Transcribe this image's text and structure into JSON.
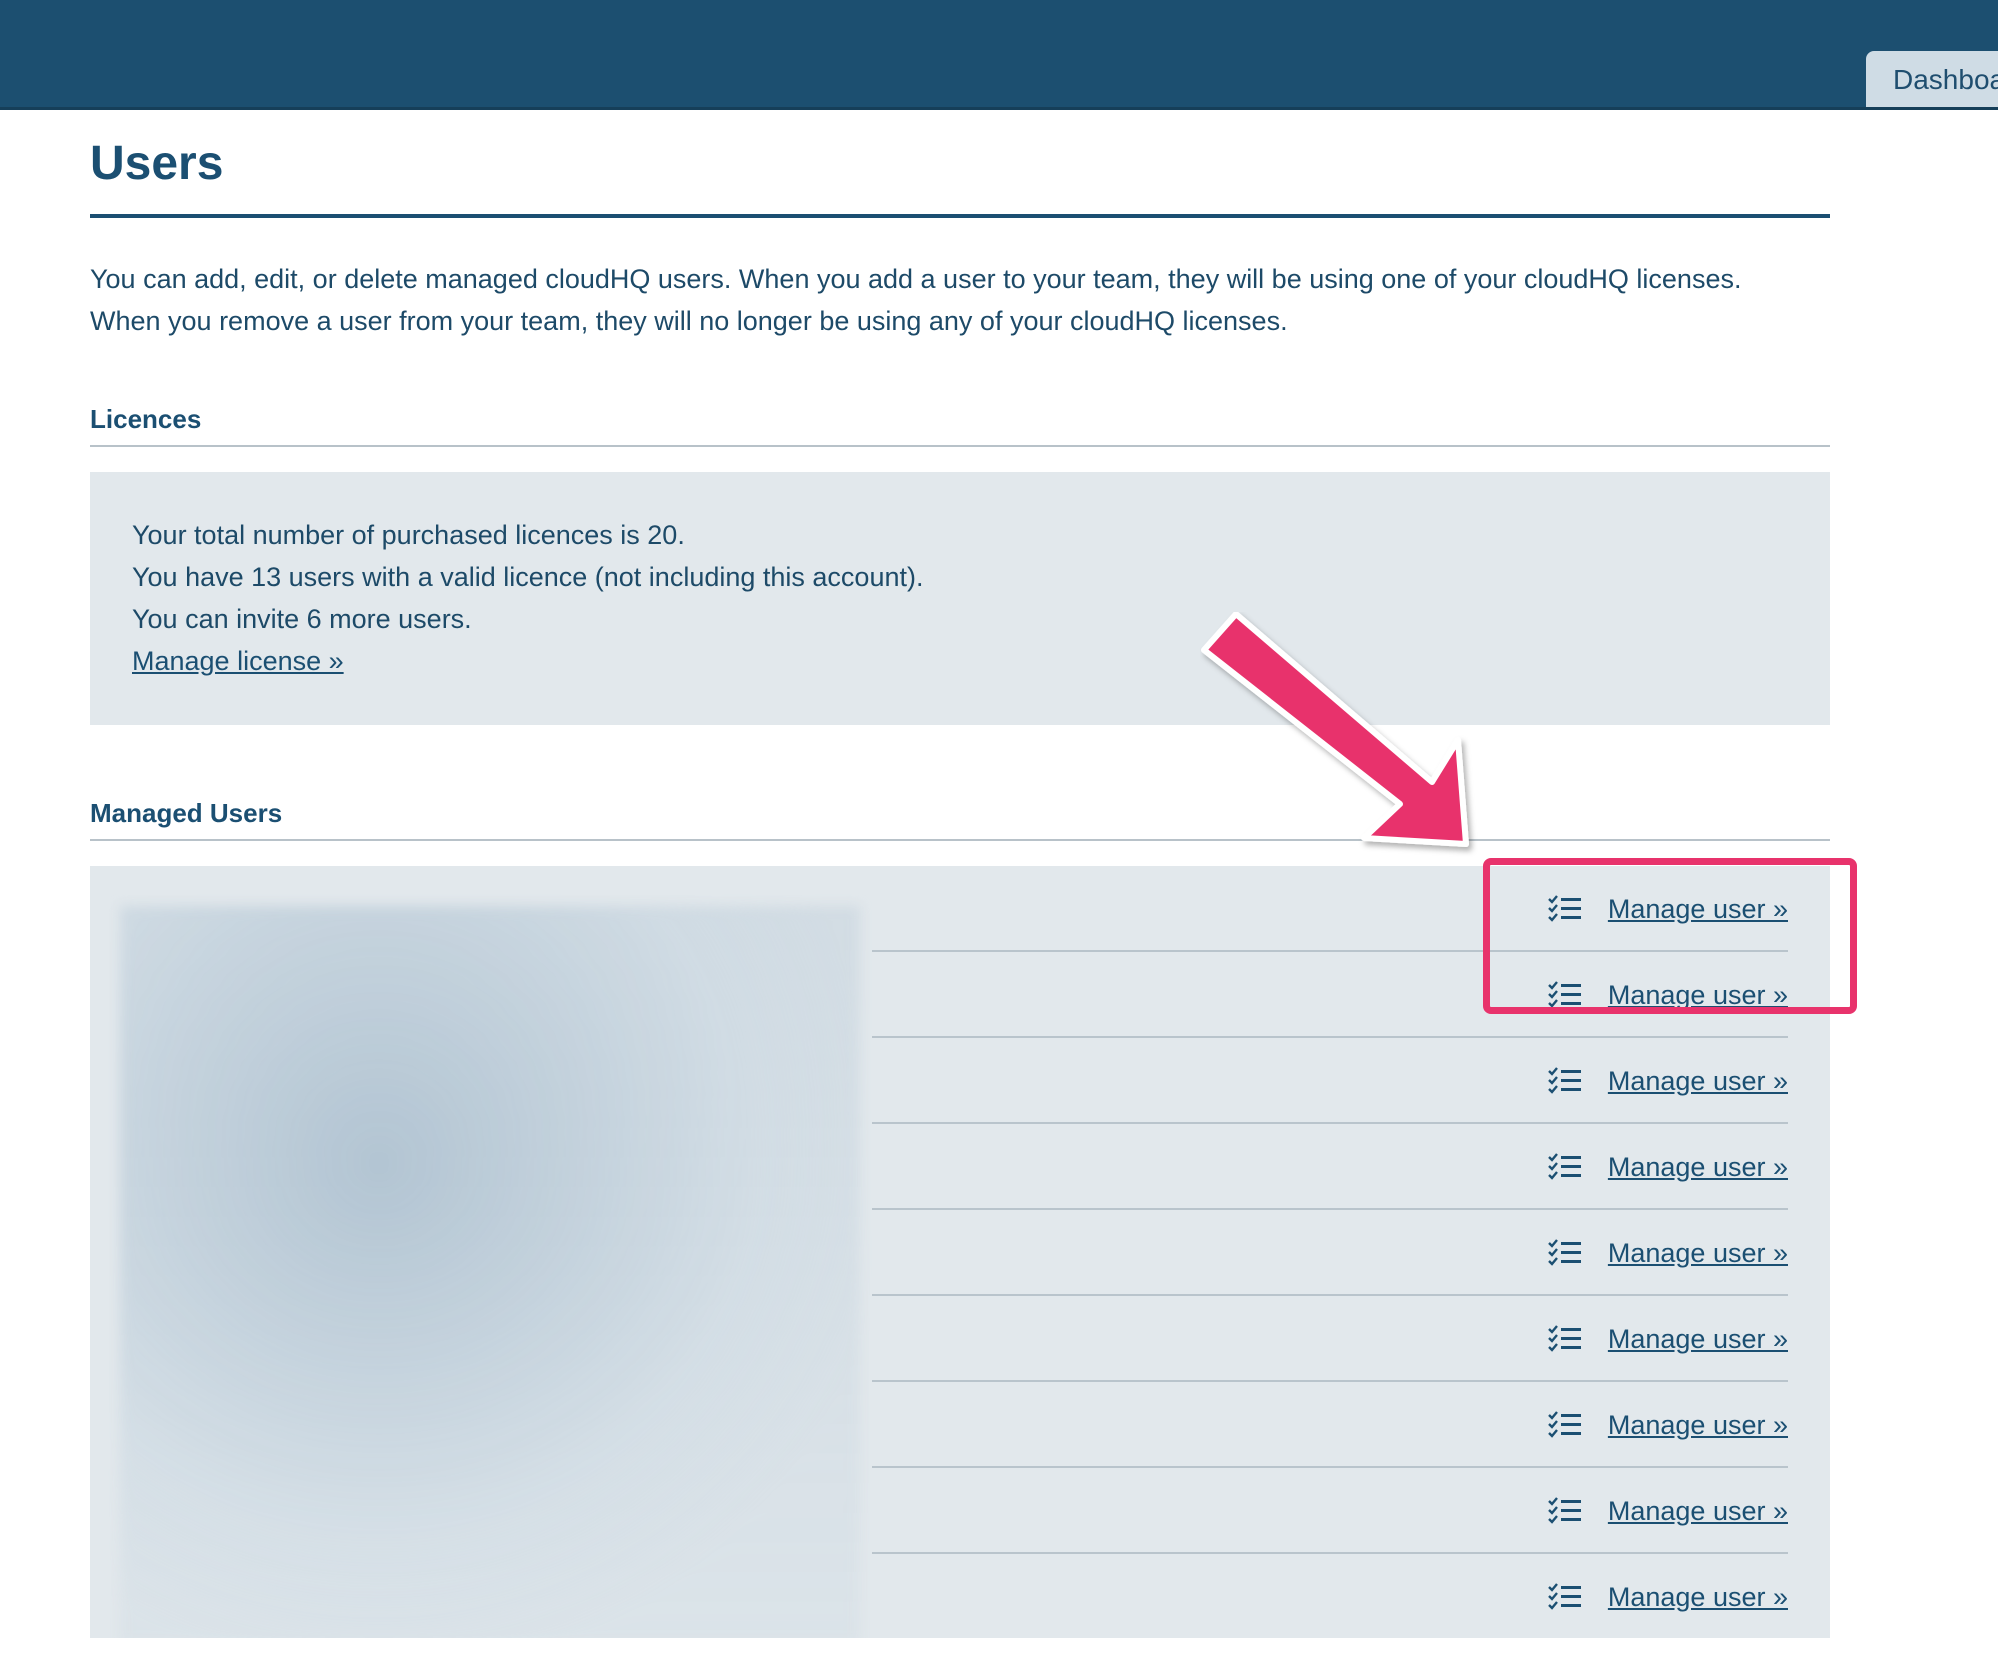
{
  "topbar": {
    "tab_label": "Dashboard"
  },
  "page": {
    "title": "Users",
    "intro_line1": "You can add, edit, or delete managed cloudHQ users. When you add a user to your team, they will be using one of your cloudHQ licenses.",
    "intro_line2": "When you remove a user from your team, they will no longer be using any of your cloudHQ licenses."
  },
  "licences": {
    "heading": "Licences",
    "line1": "Your total number of purchased licences is 20.",
    "line2": "You have 13 users with a valid licence (not including this account).",
    "line3": "You can invite 6 more users.",
    "manage_link": "Manage license »"
  },
  "managed_users": {
    "heading": "Managed Users",
    "rows": [
      {
        "action": "Manage user »"
      },
      {
        "action": "Manage user »"
      },
      {
        "action": "Manage user »"
      },
      {
        "action": "Manage user »"
      },
      {
        "action": "Manage user »"
      },
      {
        "action": "Manage user »"
      },
      {
        "action": "Manage user »"
      },
      {
        "action": "Manage user »"
      },
      {
        "action": "Manage user »"
      }
    ]
  },
  "annotation": {
    "highlight_color": "#e8336c"
  },
  "colors": {
    "topbar": "#1c4f70",
    "panel": "#e2e8ec",
    "text": "#1b4f72"
  }
}
